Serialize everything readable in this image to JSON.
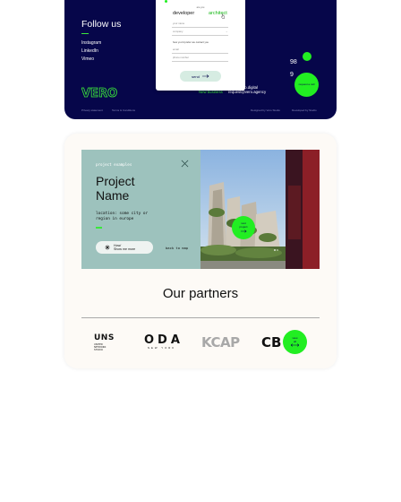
{
  "footer": {
    "follow_title": "Follow us",
    "social_links": [
      "Instagram",
      "LinkedIn",
      "Vimeo"
    ],
    "logo_text": "VERO",
    "contact_lines": [
      "98",
      "9"
    ],
    "hire_label": "New business",
    "hire_email_1": "jobs@vero.digital",
    "hire_email_2": "request@vero.agency",
    "request_button": "request a call",
    "legal_links": [
      "Privacy statement",
      "Terms & Conditions",
      "Designed by Vero Studio",
      "Developed by Studio"
    ]
  },
  "form": {
    "question": "are you",
    "option_developer": "developer",
    "option_architect": "architect",
    "field_your_name": "your name",
    "field_company": "company",
    "contact_prompt": "how you'd prefer we contact you",
    "field_email": "email",
    "field_phone": "phone number",
    "send_label": "send"
  },
  "project": {
    "label": "project examples",
    "name_line1": "Project",
    "name_line2": "Name",
    "location_line1": "location: some city or",
    "location_line2": "region in europe",
    "show_more_line1": "How/",
    "show_more_line2": "Show me more",
    "back_to_map": "back to map",
    "next_line1": "next",
    "next_line2": "project"
  },
  "partners": {
    "title": "Our partners",
    "logos": {
      "uns": "UNS",
      "uns_sub_1": "UNITED",
      "uns_sub_2": "NETWORK",
      "uns_sub_3": "STUDIO",
      "oda": "ODA",
      "oda_sub": "NEW YORK",
      "kcap": "KCAP",
      "cb": "CB"
    },
    "view_line1": "view",
    "view_line2": "all"
  },
  "colors": {
    "navy": "#06064a",
    "accent_green": "#22ee22",
    "panel_teal": "#9dc2bd",
    "card_bg": "#fdfaf6"
  }
}
